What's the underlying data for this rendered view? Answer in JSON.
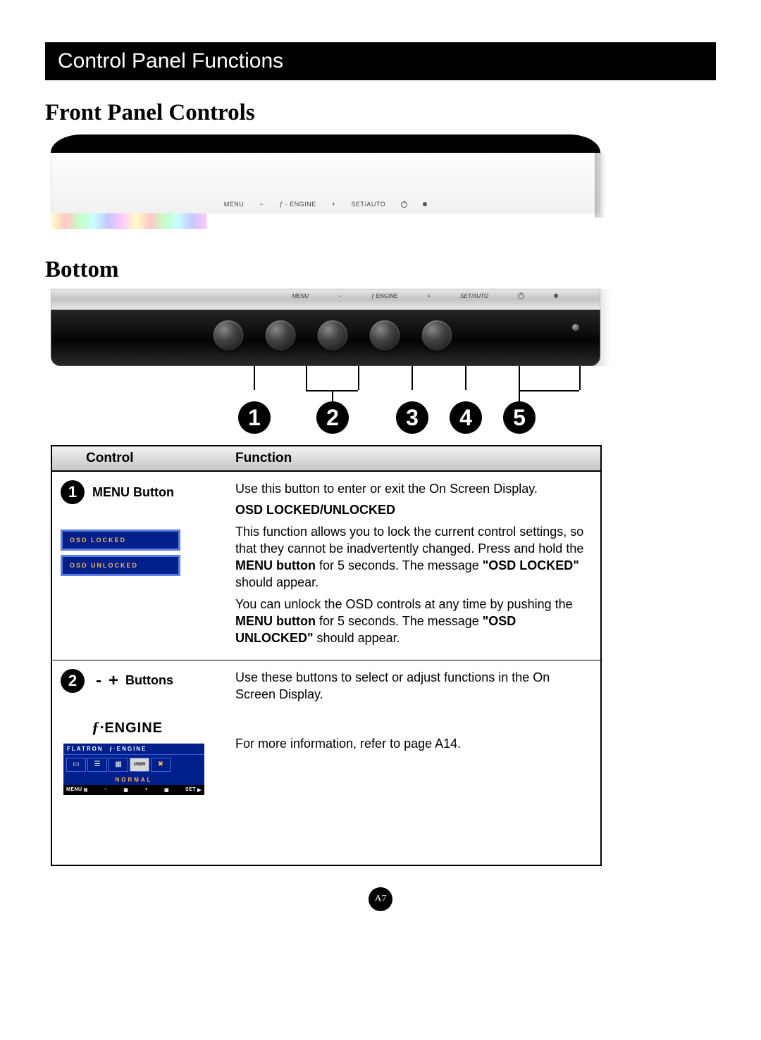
{
  "title_bar": "Control Panel Functions",
  "heading_front": "Front Panel Controls",
  "heading_bottom": "Bottom",
  "front_labels": {
    "menu": "MENU",
    "minus": "−",
    "engine_prefix": "ƒ",
    "engine_suffix": "ENGINE",
    "plus": "+",
    "setauto": "SET/AUTO"
  },
  "callout_numbers": [
    "1",
    "2",
    "3",
    "4",
    "5"
  ],
  "table": {
    "head_control": "Control",
    "head_function": "Function"
  },
  "row1": {
    "badge": "1",
    "control_label": "MENU Button",
    "func_intro": "Use this button to enter or exit the On Screen Display.",
    "osd_title": "OSD LOCKED/UNLOCKED",
    "osd_para1_a": "This function allows you to lock the current control settings, so that they cannot be inadvertently changed. Press and hold the ",
    "osd_para1_b": "MENU button",
    "osd_para1_c": " for 5 seconds. The message ",
    "osd_para1_d": "\"OSD LOCKED\"",
    "osd_para1_e": " should appear.",
    "osd_para2_a": "You can unlock the OSD controls at any time by pushing the ",
    "osd_para2_b": "MENU button",
    "osd_para2_c": " for 5 seconds. The message ",
    "osd_para2_d": "\"OSD UNLOCKED\"",
    "osd_para2_e": " should appear.",
    "pill_locked": "OSD LOCKED",
    "pill_unlocked": "OSD UNLOCKED"
  },
  "row2": {
    "badge": "2",
    "minus": "-",
    "plus": "+",
    "buttons_label": "Buttons",
    "buttons_func": "Use these buttons to select or adjust functions in the On Screen Display.",
    "engine_f": "ƒ",
    "engine_dot": "·",
    "engine_txt": "ENGINE",
    "engine_func": "For more information, refer to page A14.",
    "panel": {
      "title_prefix": "FLATRON",
      "title_f": "ƒ",
      "title_engine": "ENGINE",
      "user": "USER",
      "normal": "NORMAL",
      "foot_menu": "MENU",
      "foot_minus": "−",
      "foot_plus": "+",
      "foot_set": "SET"
    }
  },
  "page_number": "A7"
}
